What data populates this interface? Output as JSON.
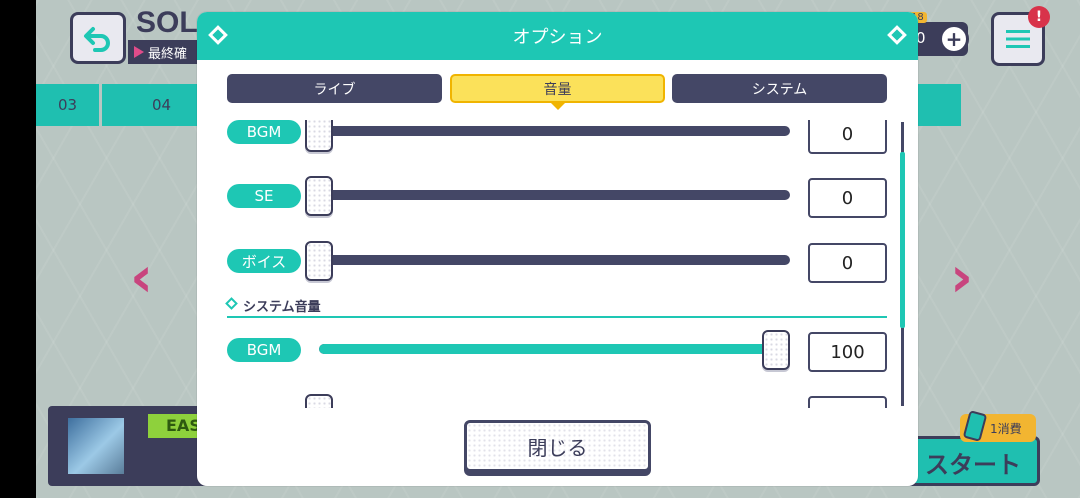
{
  "background": {
    "title": "SOL",
    "subtitle": "最終確",
    "tabs": [
      {
        "label": "03"
      },
      {
        "label": "04"
      },
      {
        "label": ""
      }
    ],
    "currency_badge": "18",
    "currency_value": "0",
    "difficulty": "EASY",
    "start_label": "スタート",
    "consume_count": "1",
    "consume_label": "消費"
  },
  "modal": {
    "title": "オプション",
    "tabs": [
      {
        "label": "ライブ",
        "active": false
      },
      {
        "label": "音量",
        "active": true
      },
      {
        "label": "システム",
        "active": false
      }
    ],
    "rows": [
      {
        "label": "BGM",
        "value": "0",
        "level": 0
      },
      {
        "label": "SE",
        "value": "0",
        "level": 0
      },
      {
        "label": "ボイス",
        "value": "0",
        "level": 0
      }
    ],
    "section_title": "システム音量",
    "system_rows": [
      {
        "label": "BGM",
        "value": "100",
        "level": 1.0
      }
    ],
    "close_label": "閉じる"
  },
  "colors": {
    "accent": "#1ec7b4",
    "navy": "#444766",
    "tab_active": "#fbe15a",
    "alert": "#d8334a",
    "arrow": "#c8457e"
  }
}
